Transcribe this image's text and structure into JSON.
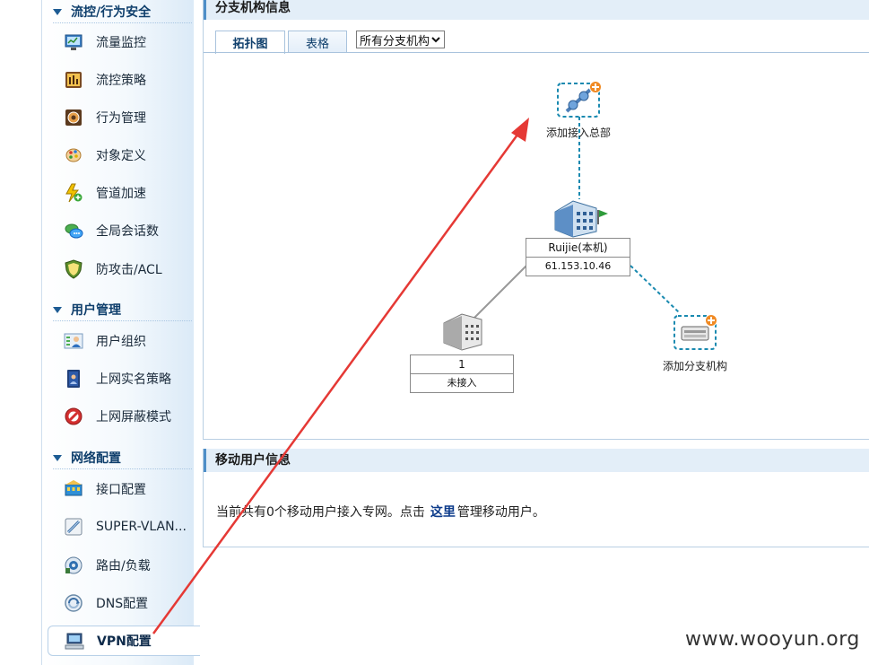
{
  "sidebar": {
    "groups": [
      {
        "title": "流控/行为安全",
        "items": [
          {
            "label": "流量监控",
            "icon": "traffic-monitor-icon"
          },
          {
            "label": "流控策略",
            "icon": "flow-policy-icon"
          },
          {
            "label": "行为管理",
            "icon": "behavior-management-icon"
          },
          {
            "label": "对象定义",
            "icon": "object-definition-icon"
          },
          {
            "label": "管道加速",
            "icon": "pipeline-acceleration-icon"
          },
          {
            "label": "全局会话数",
            "icon": "global-sessions-icon"
          },
          {
            "label": "防攻击/ACL",
            "icon": "shield-icon"
          }
        ]
      },
      {
        "title": "用户管理",
        "items": [
          {
            "label": "用户组织",
            "icon": "user-organization-icon"
          },
          {
            "label": "上网实名策略",
            "icon": "realname-policy-icon"
          },
          {
            "label": "上网屏蔽模式",
            "icon": "block-mode-icon"
          }
        ]
      },
      {
        "title": "网络配置",
        "items": [
          {
            "label": "接口配置",
            "icon": "interface-config-icon"
          },
          {
            "label": "SUPER-VLAN...",
            "icon": "super-vlan-icon"
          },
          {
            "label": "路由/负载",
            "icon": "routing-icon"
          },
          {
            "label": "DNS配置",
            "icon": "dns-icon"
          },
          {
            "label": "VPN配置",
            "icon": "vpn-computer-icon",
            "active": true
          }
        ]
      }
    ]
  },
  "branch_panel": {
    "title": "分支机构信息",
    "tabs": [
      {
        "label": "拓扑图",
        "active": true
      },
      {
        "label": "表格",
        "active": false
      }
    ],
    "select_value": "所有分支机构"
  },
  "topology": {
    "add_hq_label": "添加接入总部",
    "local_name": "Ruijie(本机)",
    "local_ip": "61.153.10.46",
    "branch_name": "1",
    "branch_status": "未接入",
    "add_branch_label": "添加分支机构"
  },
  "mobile_panel": {
    "title": "移动用户信息",
    "text_before": "当前共有0个移动用户接入专网。点击",
    "link": "这里",
    "text_after": "管理移动用户。"
  },
  "watermark": "www.wooyun.org",
  "colors": {
    "accent": "#4f8fc8",
    "annotation_arrow": "#e53935",
    "header_bg": "#e3eef8"
  }
}
